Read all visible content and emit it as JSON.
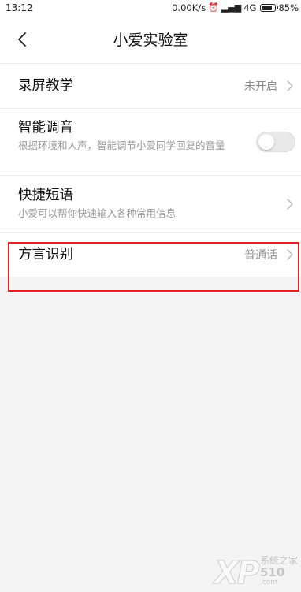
{
  "status_bar": {
    "time": "13:12",
    "net_speed": "0.00K/s",
    "network": "4G",
    "battery": "85%"
  },
  "header": {
    "title": "小爱实验室",
    "back_icon": "chevron-left-icon"
  },
  "items": [
    {
      "title": "录屏教学",
      "value": "未开启",
      "control": "chevron"
    },
    {
      "title": "智能调音",
      "subtitle": "根据环境和人声，智能调节小爱同学回复的音量",
      "control": "toggle",
      "toggle_on": false
    },
    {
      "title": "快捷短语",
      "subtitle": "小爱可以帮你快速输入各种常用信息",
      "control": "chevron"
    },
    {
      "title": "方言识别",
      "value": "普通话",
      "control": "chevron",
      "highlighted": true
    }
  ],
  "colors": {
    "highlight": "#e02020",
    "background": "#f4f4f4"
  },
  "watermark": {
    "logo": "XP",
    "text_cn": "系统之家",
    "text_num": "510",
    "text_domain": ".com"
  }
}
